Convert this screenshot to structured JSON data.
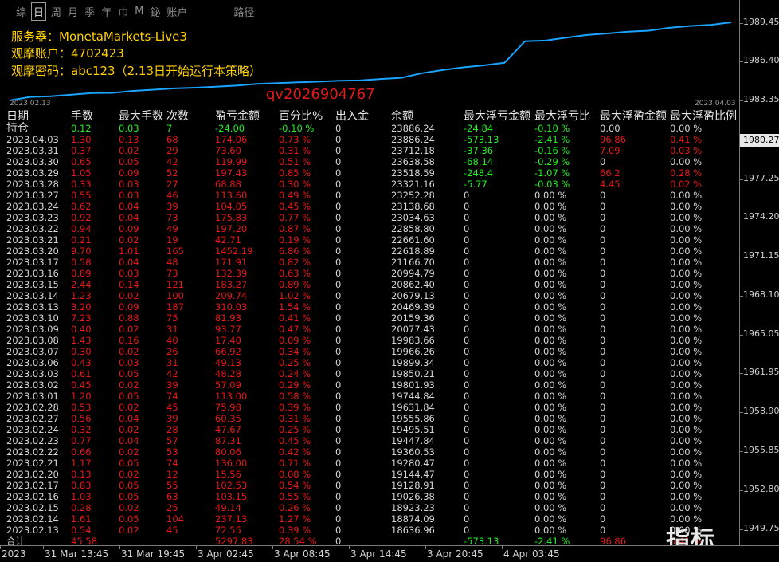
{
  "toolbar": {
    "timeframes": [
      "综",
      "日",
      "周",
      "月",
      "季",
      "年",
      "巾",
      "M",
      "鉍",
      "账户"
    ],
    "active_index": 1,
    "extra": "路径"
  },
  "info": {
    "server": "服务器：MonetaMarkets-Live3",
    "account": "观摩账户：4702423",
    "password": "观摩密码：abc123（2.13日开始运行本策略）"
  },
  "equity_dates": {
    "start": "2023.02.13",
    "end": "2023.04.03"
  },
  "watermark": "qv2026904767",
  "table": {
    "headers": [
      "日期",
      "手数",
      "最大手数",
      "次数",
      "盈亏金额",
      "百分比%",
      "出入金",
      "余额",
      "最大浮亏金额",
      "最大浮亏比",
      "最大浮盈金额",
      "最大浮盈比例"
    ],
    "summary_rows": [
      [
        "持仓",
        "0.12",
        "0.03",
        "7",
        "-24.00",
        "-0.10 %",
        "0",
        "23886.24",
        "-24.84",
        "-0.10 %",
        "0.00",
        "0.00 %"
      ]
    ],
    "rows": [
      [
        "2023.04.03",
        "1.30",
        "0.13",
        "68",
        "174.06",
        "0.73 %",
        "0",
        "23886.24",
        "-573.13",
        "-2.41 %",
        "96.86",
        "0.41 %"
      ],
      [
        "2023.03.31",
        "0.37",
        "0.02",
        "29",
        "73.60",
        "0.31 %",
        "0",
        "23712.18",
        "-37.36",
        "-0.16 %",
        "7.09",
        "0.03 %"
      ],
      [
        "2023.03.30",
        "0.65",
        "0.05",
        "42",
        "119.99",
        "0.51 %",
        "0",
        "23638.58",
        "-68.14",
        "-0.29 %",
        "0",
        "0.00 %"
      ],
      [
        "2023.03.29",
        "1.05",
        "0.09",
        "52",
        "197.43",
        "0.85 %",
        "0",
        "23518.59",
        "-248.4",
        "-1.07 %",
        "66.2",
        "0.28 %"
      ],
      [
        "2023.03.28",
        "0.33",
        "0.03",
        "27",
        "68.88",
        "0.30 %",
        "0",
        "23321.16",
        "-5.77",
        "-0.03 %",
        "4.45",
        "0.02 %"
      ],
      [
        "2023.03.27",
        "0.55",
        "0.03",
        "46",
        "113.60",
        "0.49 %",
        "0",
        "23252.28",
        "0",
        "0.00 %",
        "0",
        "0.00 %"
      ],
      [
        "2023.03.24",
        "0.62",
        "0.04",
        "39",
        "104.05",
        "0.45 %",
        "0",
        "23138.68",
        "0",
        "0.00 %",
        "0",
        "0.00 %"
      ],
      [
        "2023.03.23",
        "0.92",
        "0.04",
        "73",
        "175.83",
        "0.77 %",
        "0",
        "23034.63",
        "0",
        "0.00 %",
        "0",
        "0.00 %"
      ],
      [
        "2023.03.22",
        "0.94",
        "0.09",
        "49",
        "197.20",
        "0.87 %",
        "0",
        "22858.80",
        "0",
        "0.00 %",
        "0",
        "0.00 %"
      ],
      [
        "2023.03.21",
        "0.21",
        "0.02",
        "19",
        "42.71",
        "0.19 %",
        "0",
        "22661.60",
        "0",
        "0.00 %",
        "0",
        "0.00 %"
      ],
      [
        "2023.03.20",
        "9.70",
        "1.01",
        "165",
        "1452.19",
        "6.86 %",
        "0",
        "22618.89",
        "0",
        "0.00 %",
        "0",
        "0.00 %"
      ],
      [
        "2023.03.17",
        "0.58",
        "0.04",
        "48",
        "171.91",
        "0.82 %",
        "0",
        "21166.70",
        "0",
        "0.00 %",
        "0",
        "0.00 %"
      ],
      [
        "2023.03.16",
        "0.89",
        "0.03",
        "73",
        "132.39",
        "0.63 %",
        "0",
        "20994.79",
        "0",
        "0.00 %",
        "0",
        "0.00 %"
      ],
      [
        "2023.03.15",
        "2.44",
        "0.14",
        "121",
        "183.27",
        "0.89 %",
        "0",
        "20862.40",
        "0",
        "0.00 %",
        "0",
        "0.00 %"
      ],
      [
        "2023.03.14",
        "1.23",
        "0.02",
        "100",
        "209.74",
        "1.02 %",
        "0",
        "20679.13",
        "0",
        "0.00 %",
        "0",
        "0.00 %"
      ],
      [
        "2023.03.13",
        "3.20",
        "0.09",
        "187",
        "310.03",
        "1.54 %",
        "0",
        "20469.39",
        "0",
        "0.00 %",
        "0",
        "0.00 %"
      ],
      [
        "2023.03.10",
        "7.23",
        "0.88",
        "75",
        "81.93",
        "0.41 %",
        "0",
        "20159.36",
        "0",
        "0.00 %",
        "0",
        "0.00 %"
      ],
      [
        "2023.03.09",
        "0.40",
        "0.02",
        "31",
        "93.77",
        "0.47 %",
        "0",
        "20077.43",
        "0",
        "0.00 %",
        "0",
        "0.00 %"
      ],
      [
        "2023.03.08",
        "1.43",
        "0.16",
        "40",
        "17.40",
        "0.09 %",
        "0",
        "19983.66",
        "0",
        "0.00 %",
        "0",
        "0.00 %"
      ],
      [
        "2023.03.07",
        "0.30",
        "0.02",
        "26",
        "66.92",
        "0.34 %",
        "0",
        "19966.26",
        "0",
        "0.00 %",
        "0",
        "0.00 %"
      ],
      [
        "2023.03.06",
        "0.43",
        "0.03",
        "31",
        "49.13",
        "0.25 %",
        "0",
        "19899.34",
        "0",
        "0.00 %",
        "0",
        "0.00 %"
      ],
      [
        "2023.03.03",
        "0.61",
        "0.05",
        "42",
        "48.28",
        "0.24 %",
        "0",
        "19850.21",
        "0",
        "0.00 %",
        "0",
        "0.00 %"
      ],
      [
        "2023.03.02",
        "0.45",
        "0.02",
        "39",
        "57.09",
        "0.29 %",
        "0",
        "19801.93",
        "0",
        "0.00 %",
        "0",
        "0.00 %"
      ],
      [
        "2023.03.01",
        "1.20",
        "0.05",
        "74",
        "113.00",
        "0.58 %",
        "0",
        "19744.84",
        "0",
        "0.00 %",
        "0",
        "0.00 %"
      ],
      [
        "2023.02.28",
        "0.53",
        "0.02",
        "45",
        "75.98",
        "0.39 %",
        "0",
        "19631.84",
        "0",
        "0.00 %",
        "0",
        "0.00 %"
      ],
      [
        "2023.02.27",
        "0.56",
        "0.04",
        "39",
        "60.35",
        "0.31 %",
        "0",
        "19555.86",
        "0",
        "0.00 %",
        "0",
        "0.00 %"
      ],
      [
        "2023.02.24",
        "0.32",
        "0.02",
        "28",
        "47.67",
        "0.25 %",
        "0",
        "19495.51",
        "0",
        "0.00 %",
        "0",
        "0.00 %"
      ],
      [
        "2023.02.23",
        "0.77",
        "0.04",
        "57",
        "87.31",
        "0.45 %",
        "0",
        "19447.84",
        "0",
        "0.00 %",
        "0",
        "0.00 %"
      ],
      [
        "2023.02.22",
        "0.66",
        "0.02",
        "53",
        "80.06",
        "0.42 %",
        "0",
        "19360.53",
        "0",
        "0.00 %",
        "0",
        "0.00 %"
      ],
      [
        "2023.02.21",
        "1.17",
        "0.05",
        "74",
        "136.00",
        "0.71 %",
        "0",
        "19280.47",
        "0",
        "0.00 %",
        "0",
        "0.00 %"
      ],
      [
        "2023.02.20",
        "0.13",
        "0.02",
        "12",
        "15.56",
        "0.08 %",
        "0",
        "19144.47",
        "0",
        "0.00 %",
        "0",
        "0.00 %"
      ],
      [
        "2023.02.17",
        "0.83",
        "0.05",
        "55",
        "102.53",
        "0.54 %",
        "0",
        "19128.91",
        "0",
        "0.00 %",
        "0",
        "0.00 %"
      ],
      [
        "2023.02.16",
        "1.03",
        "0.05",
        "63",
        "103.15",
        "0.55 %",
        "0",
        "19026.38",
        "0",
        "0.00 %",
        "0",
        "0.00 %"
      ],
      [
        "2023.02.15",
        "0.28",
        "0.02",
        "25",
        "49.14",
        "0.26 %",
        "0",
        "18923.23",
        "0",
        "0.00 %",
        "0",
        "0.00 %"
      ],
      [
        "2023.02.14",
        "1.61",
        "0.05",
        "104",
        "237.13",
        "1.27 %",
        "0",
        "18874.09",
        "0",
        "0.00 %",
        "0",
        "0.00 %"
      ],
      [
        "2023.02.13",
        "0.54",
        "0.02",
        "45",
        "72.55",
        "0.39 %",
        "0",
        "18636.96",
        "0",
        "0.00 %",
        "0",
        "0.00 %"
      ]
    ],
    "total_label": "合计",
    "total_rows": [
      [
        "合计",
        "45.58",
        "",
        "",
        "5297.83",
        "28.54 %",
        "0",
        "",
        "-573.13",
        "-2.41 %",
        "96.86",
        "0.41 %"
      ]
    ]
  },
  "y_axis": {
    "ticks": [
      "1989.45",
      "1986.40",
      "1983.35",
      "1977.25",
      "1974.20",
      "1971.15",
      "1968.10",
      "1965.05",
      "1961.95",
      "1958.90",
      "1955.85",
      "1952.80",
      "1949.75"
    ],
    "current": "1980.27"
  },
  "x_axis": {
    "labels": [
      "2023",
      "31 Mar 13:45",
      "31 Mar 19:45",
      "3 Apr 02:45",
      "3 Apr 08:45",
      "3 Apr 14:45",
      "3 Apr 20:45",
      "4 Apr 03:45"
    ]
  },
  "logo": "指标铺",
  "colors": {
    "equity_line": "#1aa3ff",
    "loss": "#e81818",
    "profit_live": "#22ee22",
    "info": "#ffd000",
    "watermark": "#e11b1b"
  }
}
